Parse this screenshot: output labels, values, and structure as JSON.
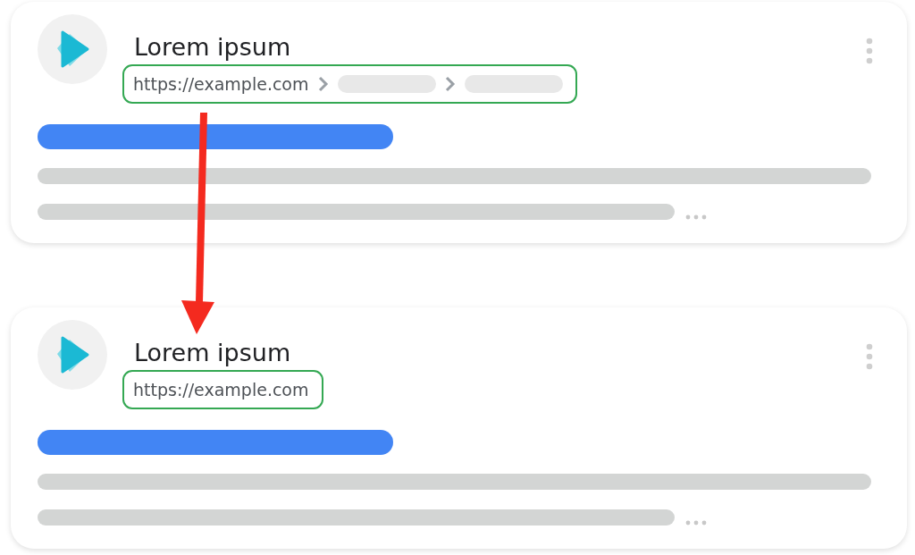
{
  "cards": [
    {
      "kind": "breadcrumb",
      "title": "Lorem ipsum",
      "url": "https://example.com"
    },
    {
      "kind": "plain",
      "title": "Lorem ipsum",
      "url": "https://example.com"
    }
  ]
}
